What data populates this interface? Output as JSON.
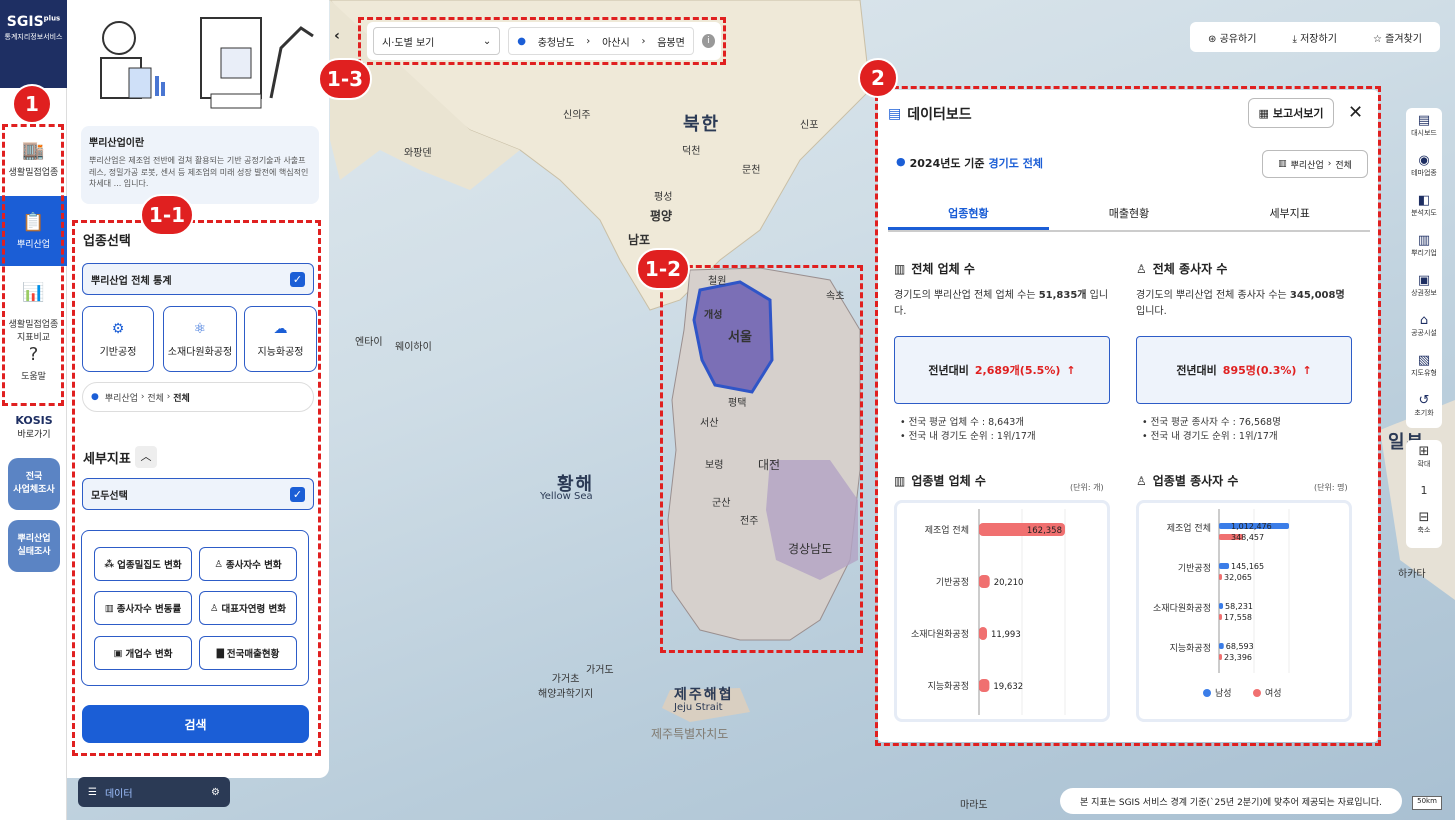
{
  "app": {
    "logo": "SGIS",
    "logo_plus": "plus",
    "logo_sub": "통계지리정보서비스"
  },
  "nav": {
    "items": [
      {
        "label": "생활밀접업종",
        "icon": "store-icon"
      },
      {
        "label": "뿌리산업",
        "icon": "industry-icon"
      },
      {
        "label": "생활밀접업종\n지표비교",
        "icon": "compare-icon"
      },
      {
        "label": "도움말",
        "icon": "help-icon"
      }
    ],
    "kosis_title": "KOSIS",
    "kosis_sub": "바로가기",
    "pill1": "전국\n사업체조사",
    "pill2": "뿌리산업\n실태조사"
  },
  "panel": {
    "intro_title": "뿌리산업이란",
    "intro_desc": "뿌리산업은 제조업 전반에 걸쳐 활용되는 기반 공정기술과 사출프레스, 정밀가공 로봇, 센서 등 제조업의 미래 성장 발전에 핵심적인 차세대 ... 입니다.",
    "industry_title": "업종선택",
    "all_stats": "뿌리산업 전체 통계",
    "categories": [
      "기반공정",
      "소재다원화공정",
      "지능화공정"
    ],
    "crumb": [
      "뿌리산업",
      "전체",
      "전체"
    ],
    "indicator_title": "세부지표",
    "select_all": "모두선택",
    "indicators": [
      "업종밀집도 변화",
      "종사자수 변화",
      "종사자수 변동률",
      "대표자연령 변화",
      "개업수 변화",
      "전국매출현황"
    ],
    "search": "검색",
    "data_label": "데이터"
  },
  "topbar": {
    "view": "시·도별 보기",
    "loc": [
      "충청남도",
      "아산시",
      "음봉면"
    ]
  },
  "topright": {
    "share": "공유하기",
    "save": "저장하기",
    "fav": "즐겨찾기"
  },
  "badges": {
    "b1": "1",
    "b11": "1-1",
    "b12": "1-2",
    "b13": "1-3",
    "b2": "2"
  },
  "map": {
    "labels": [
      {
        "t": "신의주"
      },
      {
        "t": "북한"
      },
      {
        "t": "신포"
      },
      {
        "t": "와팡덴"
      },
      {
        "t": "덕천"
      },
      {
        "t": "문천"
      },
      {
        "t": "평성"
      },
      {
        "t": "평양"
      },
      {
        "t": "남포"
      },
      {
        "t": "황해"
      },
      {
        "t": "Yellow Sea"
      },
      {
        "t": "엔타이"
      },
      {
        "t": "웨이하이"
      },
      {
        "t": "개성"
      },
      {
        "t": "서울"
      },
      {
        "t": "철원"
      },
      {
        "t": "속초"
      },
      {
        "t": "평택"
      },
      {
        "t": "서산"
      },
      {
        "t": "보령"
      },
      {
        "t": "대전"
      },
      {
        "t": "군산"
      },
      {
        "t": "전주"
      },
      {
        "t": "경상남도"
      },
      {
        "t": "가거도"
      },
      {
        "t": "가거초\n해양과학기지"
      },
      {
        "t": "제주해협"
      },
      {
        "t": "Jeju Strait"
      },
      {
        "t": "제주특별자치도"
      },
      {
        "t": "일본"
      },
      {
        "t": "마라도"
      },
      {
        "t": "하카타"
      }
    ]
  },
  "dashboard": {
    "title": "데이터보드",
    "report_btn": "보고서보기",
    "basis": "2024년도 기준",
    "region": "경기도 전체",
    "crumb": [
      "뿌리산업",
      "전체"
    ],
    "tabs": [
      "업종현황",
      "매출현황",
      "세부지표"
    ],
    "biz_title": "전체 업체 수",
    "biz_desc_pre": "경기도의 뿌리산업 전체 업체 수는 ",
    "biz_desc_val": "51,835개",
    "biz_desc_post": " 입니다.",
    "emp_title": "전체 종사자 수",
    "emp_desc_pre": "경기도의 뿌리산업 전체 종사자 수는 ",
    "emp_desc_val": "345,008명",
    "emp_desc_post": " 입니다.",
    "yoy_label": "전년대비",
    "biz_yoy": "2,689개(5.5%)",
    "emp_yoy": "895명(0.3%)",
    "biz_bul1": "전국 평균 업체 수 : 8,643개",
    "biz_bul2": "전국 내 경기도 순위 : 1위/17개",
    "emp_bul1": "전국 평균 종사자 수 : 76,568명",
    "emp_bul2": "전국 내 경기도 순위 : 1위/17개",
    "chart1_title": "업종별 업체 수",
    "chart1_unit": "(단위: 개)",
    "chart2_title": "업종별 종사자 수",
    "chart2_unit": "(단위: 명)",
    "legend_m": "남성",
    "legend_f": "여성"
  },
  "chart_data": [
    {
      "type": "bar",
      "title": "업종별 업체 수",
      "categories": [
        "제조업 전체",
        "기반공정",
        "소재다원화공정",
        "지능화공정"
      ],
      "values": [
        162358,
        20210,
        11993,
        19632
      ],
      "labels": [
        "162,358",
        "20,210",
        "11,993",
        "19,632"
      ],
      "color": "#f07070"
    },
    {
      "type": "bar",
      "title": "업종별 종사자 수",
      "categories": [
        "제조업 전체",
        "기반공정",
        "소재다원화공정",
        "지능화공정"
      ],
      "series": [
        {
          "name": "남성",
          "values": [
            1012476,
            145165,
            58231,
            68593
          ],
          "labels": [
            "1,012,476",
            "145,165",
            "58,231",
            "68,593"
          ],
          "color": "#3b7de8"
        },
        {
          "name": "여성",
          "values": [
            348457,
            32065,
            17558,
            23396
          ],
          "labels": [
            "348,457",
            "32,065",
            "17,558",
            "23,396"
          ],
          "color": "#f07070"
        }
      ]
    }
  ],
  "rtools": [
    "대시보드",
    "테마업종",
    "분석지도",
    "뿌리기업",
    "상권정보",
    "공공시설",
    "지도유형",
    "초기화"
  ],
  "zoom": {
    "in": "확대",
    "level": "1",
    "out": "축소"
  },
  "footnote": "본 지표는 SGIS 서비스 경계 기준(`25년 2분기)에 맞추어 제공되는 자료입니다.",
  "scale": "50km"
}
